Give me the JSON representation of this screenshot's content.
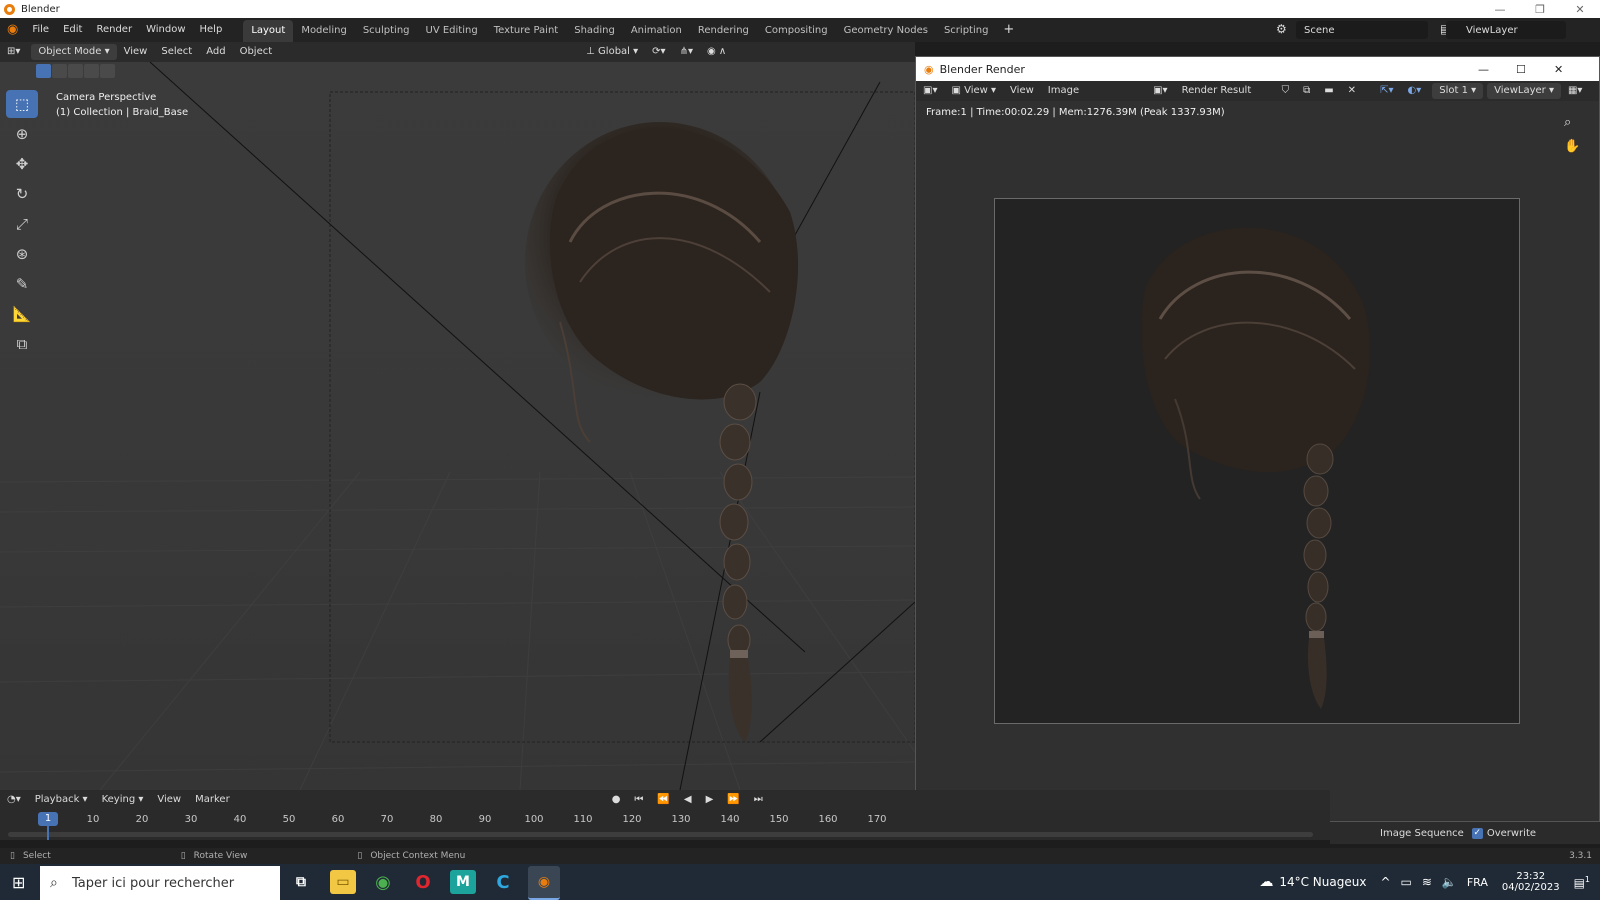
{
  "window": {
    "title": "Blender"
  },
  "menu": [
    "File",
    "Edit",
    "Render",
    "Window",
    "Help"
  ],
  "workspaces": [
    "Layout",
    "Modeling",
    "Sculpting",
    "UV Editing",
    "Texture Paint",
    "Shading",
    "Animation",
    "Rendering",
    "Compositing",
    "Geometry Nodes",
    "Scripting"
  ],
  "scene": {
    "name": "Scene"
  },
  "view_layer": {
    "name": "ViewLayer"
  },
  "viewport_header": {
    "mode": "Object Mode",
    "menus": [
      "View",
      "Select",
      "Add",
      "Object"
    ],
    "orientation": "Global"
  },
  "viewport_info": {
    "line1": "Camera Perspective",
    "line2": "(1) Collection | Braid_Base"
  },
  "render_window": {
    "title": "Blender Render",
    "menus": [
      "View",
      "View",
      "Image"
    ],
    "image_name": "Render Result",
    "slot": "Slot 1",
    "layer": "ViewLayer",
    "stats": "Frame:1 | Time:00:02.29 | Mem:1276.39M (Peak 1337.93M)"
  },
  "timeline": {
    "menus": [
      "Playback",
      "Keying",
      "View",
      "Marker"
    ],
    "current_frame": "1",
    "frame_labels": [
      "10",
      "20",
      "30",
      "40",
      "50",
      "60",
      "70",
      "80",
      "90",
      "100",
      "110",
      "120",
      "130",
      "140",
      "150",
      "160",
      "170"
    ]
  },
  "output_options": {
    "image_sequence": "Image Sequence",
    "overwrite": "Overwrite"
  },
  "statusbar": {
    "select": "Select",
    "rotate": "Rotate View",
    "context": "Object Context Menu",
    "version": "3.3.1"
  },
  "taskbar": {
    "search_placeholder": "Taper ici pour rechercher",
    "weather": "14°C Nuageux",
    "language": "FRA",
    "time": "23:32",
    "date": "04/02/2023",
    "notifications": "1"
  },
  "colors": {
    "accent": "#4772b3",
    "blender_orange": "#e87d0d"
  }
}
